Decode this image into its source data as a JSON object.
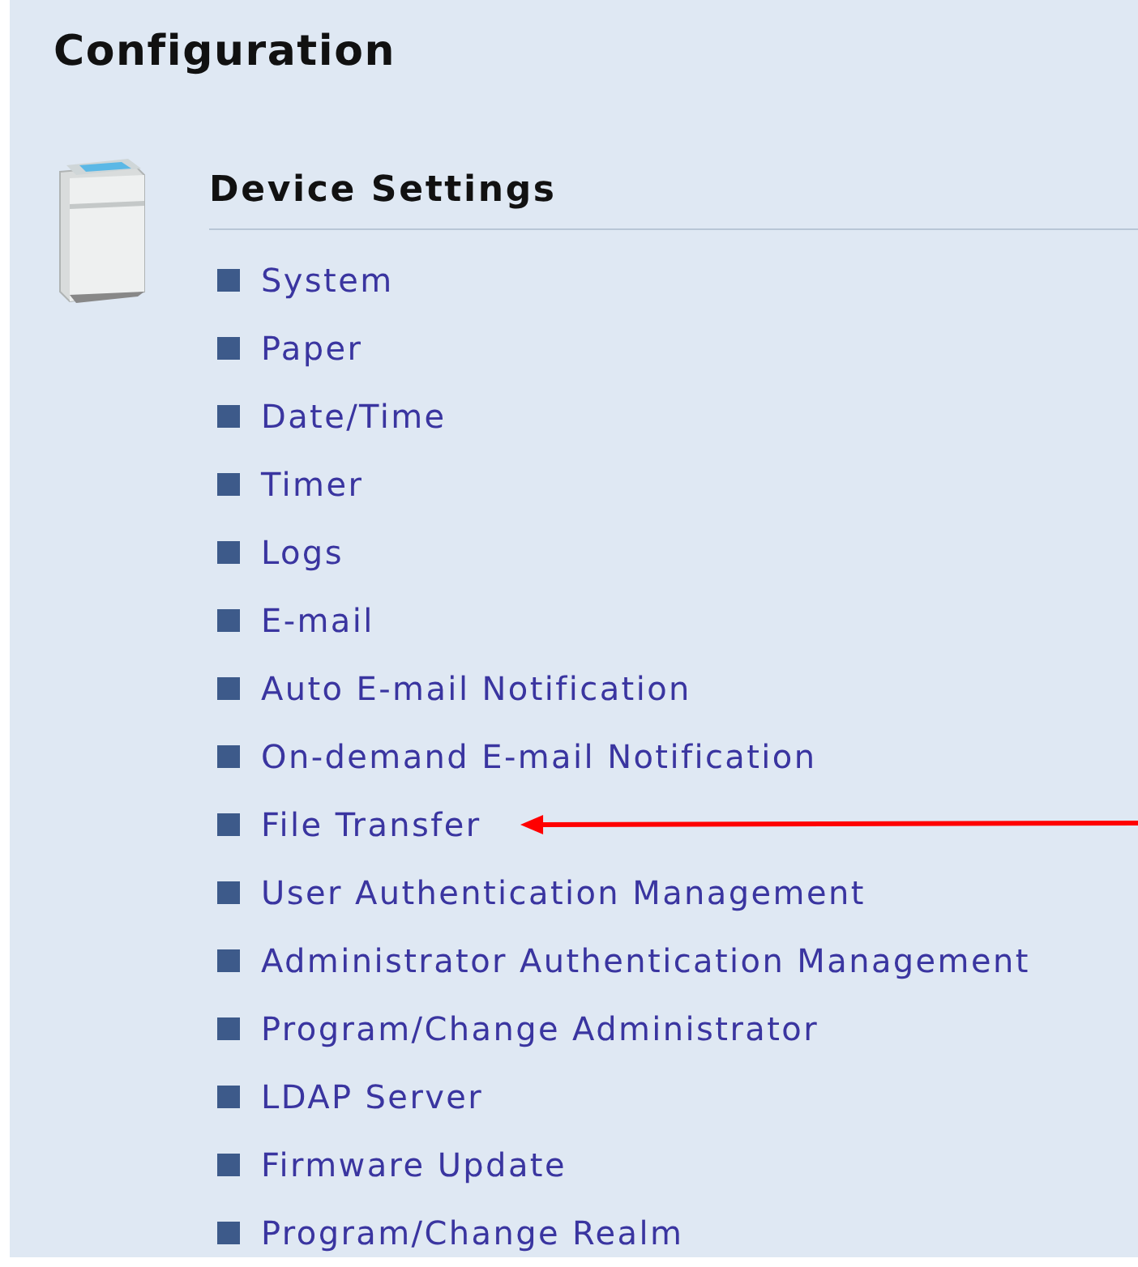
{
  "title": "Configuration",
  "section": {
    "title": "Device Settings",
    "items": [
      {
        "label": "System",
        "arrow": false
      },
      {
        "label": "Paper",
        "arrow": false
      },
      {
        "label": "Date/Time",
        "arrow": false
      },
      {
        "label": "Timer",
        "arrow": false
      },
      {
        "label": "Logs",
        "arrow": false
      },
      {
        "label": "E-mail",
        "arrow": false
      },
      {
        "label": "Auto E-mail Notification",
        "arrow": false
      },
      {
        "label": "On-demand E-mail Notification",
        "arrow": false
      },
      {
        "label": "File Transfer",
        "arrow": true
      },
      {
        "label": "User Authentication Management",
        "arrow": false
      },
      {
        "label": "Administrator Authentication Management",
        "arrow": false
      },
      {
        "label": "Program/Change Administrator",
        "arrow": false
      },
      {
        "label": "LDAP Server",
        "arrow": false
      },
      {
        "label": "Firmware Update",
        "arrow": false
      },
      {
        "label": "Program/Change Realm",
        "arrow": false
      }
    ]
  }
}
